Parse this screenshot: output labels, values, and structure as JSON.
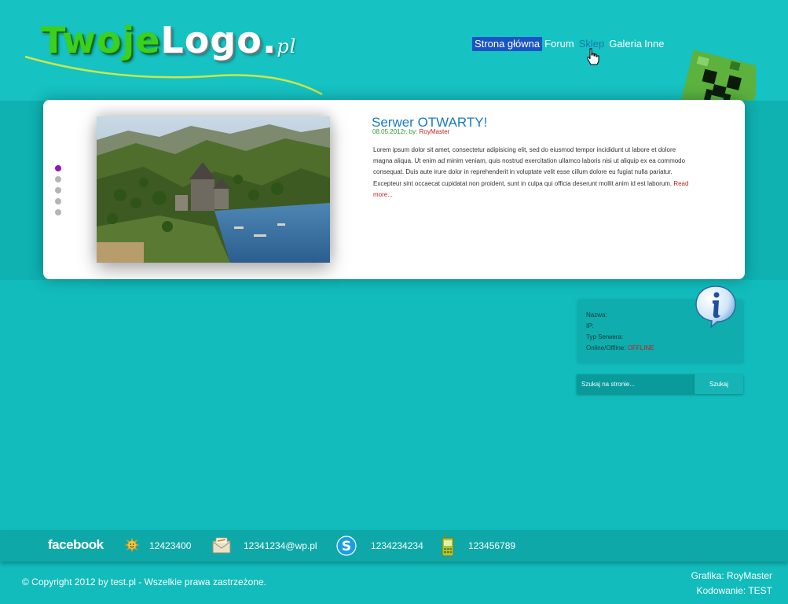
{
  "logo": {
    "part1": "Twoje",
    "part2": "Logo",
    "dot": ".",
    "suffix": "pl"
  },
  "nav": {
    "items": [
      {
        "label": "Strona główna",
        "state": "active"
      },
      {
        "label": "Forum",
        "state": "normal"
      },
      {
        "label": "Sklep",
        "state": "hover"
      },
      {
        "label": "Galeria",
        "state": "normal"
      },
      {
        "label": "Inne",
        "state": "normal"
      }
    ]
  },
  "slider": {
    "title": "Serwer OTWARTY!",
    "date": "08.05.2012r. by:",
    "author": "RoyMaster",
    "body": "Lorem ipsum dolor sit amet, consectetur adipisicing elit, sed do eiusmod tempor incididunt ut labore et dolore magna aliqua. Ut enim ad minim veniam, quis nostrud exercitation ullamco laboris nisi ut aliquip ex ea commodo consequat. Duis aute irure dolor in reprehenderit in voluptate velit esse cillum dolore eu fugiat nulla pariatur. Excepteur sint occaecat cupidatat non proident, sunt in culpa qui officia deserunt mollit anim id est laborum.",
    "read_more": "Read more...",
    "dots_count": 5,
    "active_dot": 1
  },
  "server_info": {
    "name_label": "Nazwa:",
    "ip_label": "IP:",
    "type_label": "Typ Serwera:",
    "status_label": "Online/Offline:",
    "status_value": "OFFLINE",
    "status_color": "#c21f1f"
  },
  "search": {
    "placeholder": "Szukaj na stronie...",
    "button_label": "Szukaj"
  },
  "footer": {
    "facebook_label": "facebook",
    "gg_number": "12423400",
    "email": "12341234@wp.pl",
    "skype": "1234234234",
    "phone": "123456789",
    "copyright": "© Copyright 2012 by test.pl - Wszelkie prawa zastrzeżone.",
    "graphics_credit": "Grafika: RoyMaster",
    "coding_credit": "Kodowanie: TEST"
  },
  "colors": {
    "background": "#12bcbc",
    "nav_active": "#1a54c4",
    "link_red": "#c21f1f",
    "title_blue": "#1a7ac4",
    "dot_active": "#9a12b8"
  }
}
